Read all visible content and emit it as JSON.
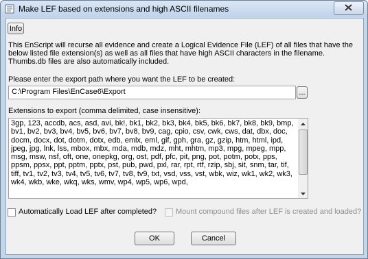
{
  "window": {
    "title": "Make LEF based on extensions and high ASCII filenames"
  },
  "info_button": "Info",
  "description": "This EnScript will recurse all evidence and create a Logical Evidence File (LEF) of all files that have the below listed file extension(s) as well as all files that have high ASCII characters in the filename. Thumbs.db files are also automatically included.",
  "export_path": {
    "label": "Please enter the export path where you want the LEF to be created:",
    "value": "C:\\Program Files\\EnCase6\\Export",
    "browse_label": "..."
  },
  "extensions": {
    "label": "Extensions to export (comma delimited, case insensitive):",
    "value": "3gp, 123, accdb, acs, asd, avi, bk!, bk1, bk2, bk3, bk4, bk5, bk6, bk7, bk8, bk9, bmp, bv1, bv2, bv3, bv4, bv5, bv6, bv7, bv8, bv9, cag, cpio, csv, cwk, cws, dat, dbx, doc, docm, docx, dot, dotm, dotx, edb, emlx, eml, gif, gph, gra, gz, gzip, htm, html, ipd, jpeg, jpg, lnk, lss, mbox, mbx, mda, mdb, mdz, mht, mhtm, mp3, mpg, mpeg, mpp, msg, msw, nsf, oft, one, onepkg, org, ost, pdf, pfc, pit, png, pot, potm, potx, pps, ppsm, ppsx, ppt, pptm, pptx, pst, pub, pwd, pxl, rar, rpt, rtf, rzip, sbj, sit, snm, tar, tif, tiff, tv1, tv2, tv3, tv4, tv5, tv6, tv7, tv8, tv9, txt, vsd, vss, vst, wbk, wiz, wk1, wk2, wk3, wk4, wkb, wke, wkq, wks, wmv, wp4, wp5, wp6, wpd,"
  },
  "options": {
    "auto_load_label": "Automatically Load LEF after completed?",
    "auto_load_checked": false,
    "mount_compound_label": "Mount compound files after LEF is created and loaded?",
    "mount_compound_checked": false,
    "mount_compound_enabled": false
  },
  "buttons": {
    "ok": "OK",
    "cancel": "Cancel"
  }
}
